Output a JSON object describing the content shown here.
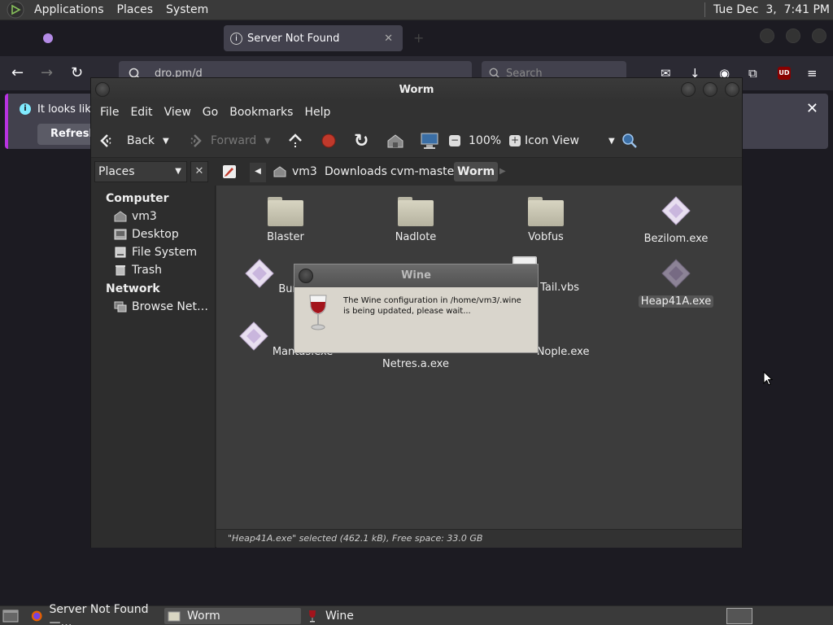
{
  "top_panel": {
    "menus": [
      "Applications",
      "Places",
      "System"
    ],
    "clock": "Tue Dec  3,  7:41 PM"
  },
  "firefox": {
    "tab_active": "Server Not Found",
    "url": "dro.pm/d",
    "search_placeholder": "Search",
    "notice": "It looks like",
    "refresh": "Refresh F",
    "ublock": "UD"
  },
  "caja": {
    "title": "Worm",
    "menus": [
      "File",
      "Edit",
      "View",
      "Go",
      "Bookmarks",
      "Help"
    ],
    "toolbar": {
      "back": "Back",
      "forward": "Forward",
      "zoom": "100%",
      "view": "Icon View"
    },
    "places_label": "Places",
    "breadcrumbs": [
      "vm3",
      "Downloads",
      "cvm-master",
      "Worm"
    ],
    "sidebar": {
      "computer": "Computer",
      "computer_items": [
        "vm3",
        "Desktop",
        "File System",
        "Trash"
      ],
      "network": "Network",
      "network_items": [
        "Browse Net…"
      ]
    },
    "files": [
      {
        "name": "Blaster",
        "type": "folder"
      },
      {
        "name": "Nadlote",
        "type": "folder"
      },
      {
        "name": "Vobfus",
        "type": "folder"
      },
      {
        "name": "Bezilom.exe",
        "type": "exe"
      },
      {
        "name": "Bumeran",
        "type": "exe"
      },
      {
        "name": "Tail.vbs",
        "type": "vbs"
      },
      {
        "name": "Heap41A.exe",
        "type": "exe"
      },
      {
        "name": "Mantas.exe",
        "type": "exe"
      },
      {
        "name": "Netres.a.exe",
        "type": "exe"
      },
      {
        "name": "Nople.exe",
        "type": "exe"
      }
    ],
    "selected_file": "Heap41A.exe",
    "status": "\"Heap41A.exe\" selected (462.1 kB), Free space: 33.0 GB"
  },
  "wine_dialog": {
    "title": "Wine",
    "message": "The Wine configuration in /home/vm3/.wine is being updated, please wait..."
  },
  "taskbar": {
    "tasks": [
      "Server Not Found —…",
      "Worm",
      "Wine"
    ]
  }
}
